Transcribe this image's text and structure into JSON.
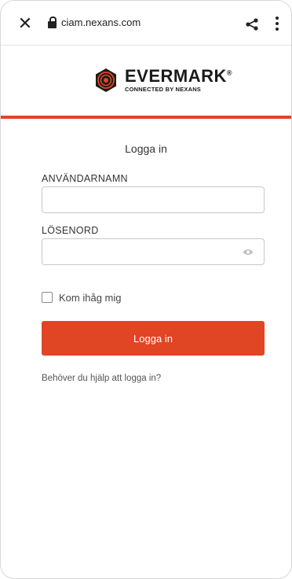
{
  "browser": {
    "url": "ciam.nexans.com"
  },
  "logo": {
    "title": "EVERMARK",
    "registered": "®",
    "subtitle": "CONNECTED BY NEXANS"
  },
  "accent_color": "#e04623",
  "form": {
    "heading": "Logga in",
    "username_label": "ANVÄNDARNAMN",
    "username_value": "",
    "password_label": "LÖSENORD",
    "password_value": "",
    "remember_label": "Kom ihåg mig",
    "remember_checked": false,
    "submit_label": "Logga in",
    "help_link": "Behöver du hjälp att logga in?"
  }
}
